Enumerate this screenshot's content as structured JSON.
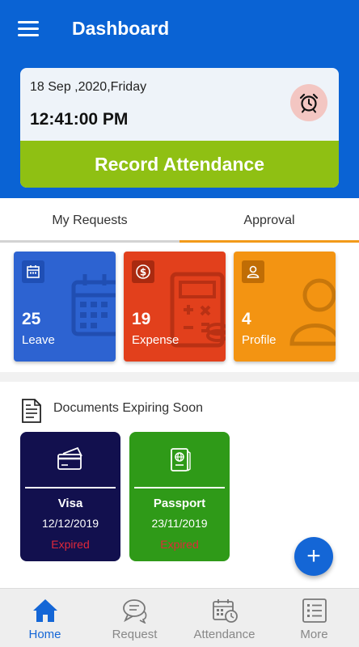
{
  "header": {
    "title": "Dashboard",
    "menu_icon": "hamburger-menu-icon",
    "background": "#0a63d4"
  },
  "attendance": {
    "date": "18 Sep ,2020,Friday",
    "time": "12:41:00 PM",
    "alarm_icon": "alarm-clock-icon",
    "record_label": "Record Attendance",
    "record_color": "#8fc013"
  },
  "tabs": [
    {
      "label": "My Requests",
      "active": false
    },
    {
      "label": "Approval",
      "active": true
    }
  ],
  "tab_colors": {
    "active_underline": "#f29a1a",
    "inactive_underline": "#d3d3d3"
  },
  "tiles": [
    {
      "count": "25",
      "label": "Leave",
      "icon": "calendar-icon",
      "color": "#2d63d1"
    },
    {
      "count": "19",
      "label": "Expense",
      "icon": "calculator-icon",
      "color": "#e2401c"
    },
    {
      "count": "4",
      "label": "Profile",
      "icon": "user-icon",
      "color": "#f39412"
    }
  ],
  "documents": {
    "title": "Documents Expiring Soon",
    "icon": "document-icon",
    "items": [
      {
        "name": "Visa",
        "date": "12/12/2019",
        "status": "Expired",
        "icon": "credit-card-icon",
        "color": "#12104e"
      },
      {
        "name": "Passport",
        "date": "23/11/2019",
        "status": "Expired",
        "icon": "passport-icon",
        "color": "#2f9a18"
      }
    ],
    "status_color": "#e0283a"
  },
  "fab": {
    "symbol": "+",
    "icon": "plus-icon",
    "color": "#1466d6"
  },
  "bottom_nav": [
    {
      "label": "Home",
      "icon": "home-icon",
      "active": true
    },
    {
      "label": "Request",
      "icon": "chat-bubbles-icon",
      "active": false
    },
    {
      "label": "Attendance",
      "icon": "calendar-clock-icon",
      "active": false
    },
    {
      "label": "More",
      "icon": "list-icon",
      "active": false
    }
  ],
  "nav_colors": {
    "active": "#1466d6",
    "inactive": "#888888"
  }
}
